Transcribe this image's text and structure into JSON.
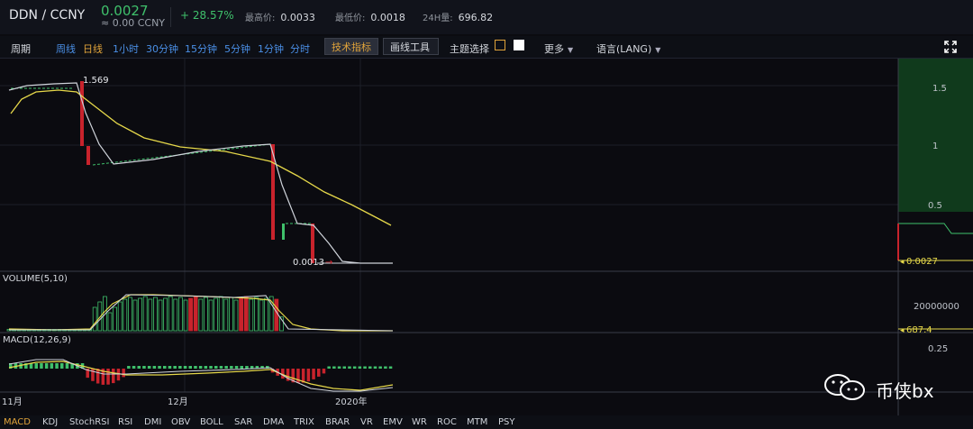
{
  "header": {
    "pair": "DDN / CCNY",
    "price": "0.0027",
    "approx": "≈ 0.00  CCNY",
    "change": "+ 28.57%",
    "high_label": "最高价:",
    "high_value": "0.0033",
    "low_label": "最低价:",
    "low_value": "0.0018",
    "vol_label": "24H量:",
    "vol_value": "696.82"
  },
  "toolbar": {
    "period": "周期",
    "intervals": [
      "周线",
      "日线",
      "1小时",
      "30分钟",
      "15分钟",
      "5分钟",
      "1分钟",
      "分时"
    ],
    "tech_btn": "技术指标",
    "draw_btn": "画线工具",
    "theme": "主题选择",
    "more": "更多",
    "lang": "语言(LANG)"
  },
  "colors": {
    "up": "#3fc06b",
    "down": "#c8232c",
    "accent": "#e0a33a",
    "ma": "#e6d84a"
  },
  "main_panel": {
    "y_ticks": [
      "1.5",
      "1",
      "0.5"
    ],
    "high_label": "1.569",
    "low_label": "0.0013",
    "last_price_label": "0.0027"
  },
  "volume_panel": {
    "title": "VOLUME(5,10)",
    "tick": "20000000",
    "last_label": "687.4"
  },
  "macd_panel": {
    "title": "MACD(12,26,9)",
    "tick": "0.25"
  },
  "x_axis": [
    "11月",
    "12月",
    "2020年"
  ],
  "indicators": [
    "MACD",
    "KDJ",
    "StochRSI",
    "RSI",
    "DMI",
    "OBV",
    "BOLL",
    "SAR",
    "DMA",
    "TRIX",
    "BRAR",
    "VR",
    "EMV",
    "WR",
    "ROC",
    "MTM",
    "PSY"
  ],
  "watermark": "币侠bx"
}
